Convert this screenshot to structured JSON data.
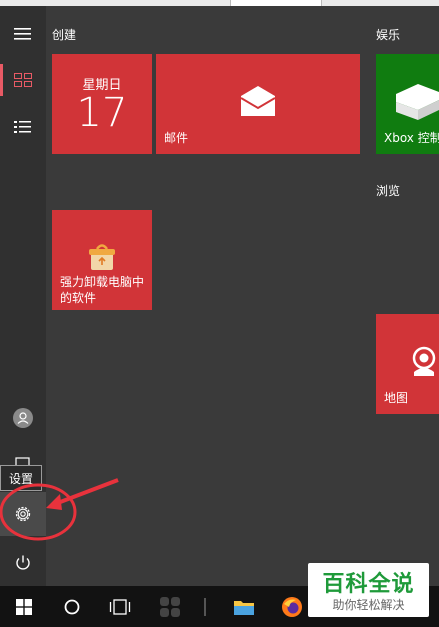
{
  "start_menu": {
    "groups": {
      "create": "创建",
      "entertainment": "娱乐",
      "browse": "浏览"
    },
    "tiles": {
      "calendar": {
        "weekday": "星期日",
        "day": "17"
      },
      "mail": {
        "label": "邮件"
      },
      "uninstaller": {
        "label_line1": "强力卸载电脑中",
        "label_line2": "的软件"
      },
      "xbox": {
        "label": "Xbox 控制"
      },
      "maps": {
        "label": "地图"
      }
    },
    "tooltip": "设置",
    "colors": {
      "tile_red": "#d13438",
      "tile_green": "#107c10",
      "annotation": "#e8323c"
    }
  },
  "watermark": {
    "title": "百科全说",
    "subtitle": "助你轻松解决"
  }
}
